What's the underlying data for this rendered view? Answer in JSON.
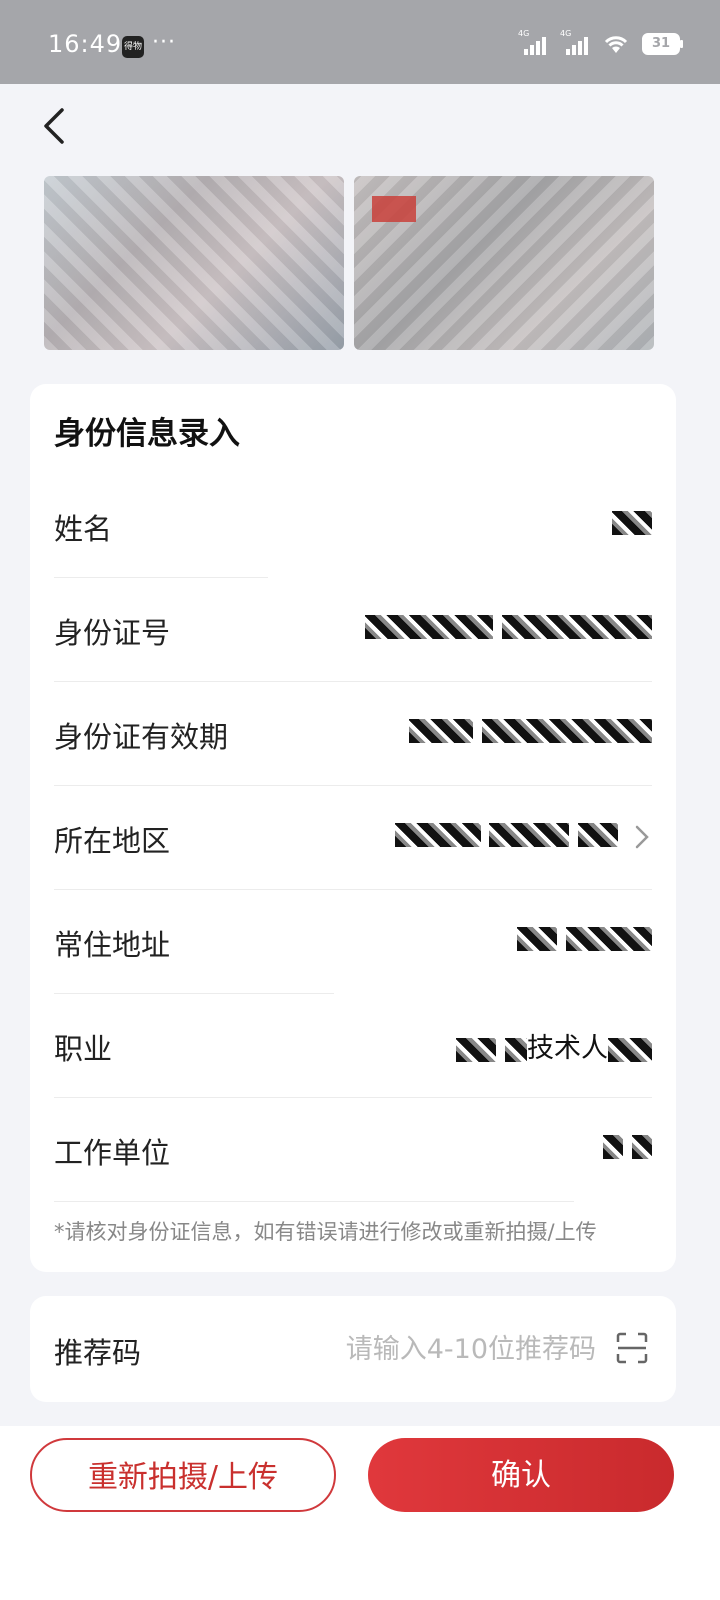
{
  "status_bar": {
    "time": "16:49",
    "app_icon_text": "得物",
    "more": "···",
    "signal1": "4G",
    "signal2": "4G",
    "battery": "31"
  },
  "nav": {
    "back_icon": "chevron-left-icon",
    "title": ""
  },
  "form": {
    "title": "身份信息录入",
    "rows": [
      {
        "label": "姓名"
      },
      {
        "label": "身份证号"
      },
      {
        "label": "身份证有效期"
      },
      {
        "label": "所在地区"
      },
      {
        "label": "常住地址"
      },
      {
        "label": "职业",
        "value_suffix": "技术人"
      },
      {
        "label": "工作单位"
      }
    ],
    "hint": "*请核对身份证信息，如有错误请进行修改或重新拍摄/上传"
  },
  "referral": {
    "label": "推荐码",
    "placeholder": "请输入4-10位推荐码",
    "scan_icon": "scan-icon"
  },
  "buttons": {
    "retake": "重新拍摄/上传",
    "confirm": "确认"
  },
  "colors": {
    "accent": "#d0393c",
    "background": "#f3f4f8",
    "status_bar": "#a5a6aa"
  }
}
